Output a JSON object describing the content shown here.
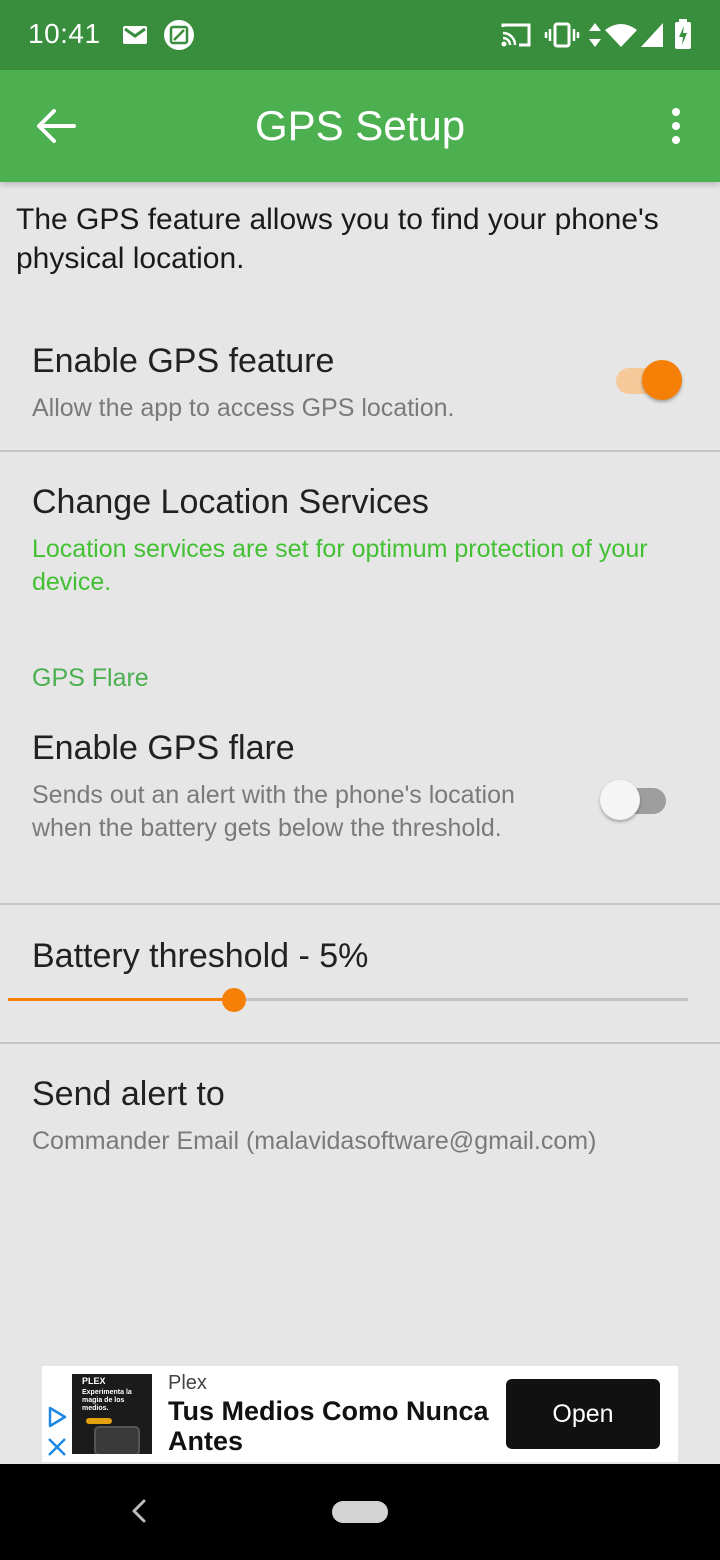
{
  "status_bar": {
    "time": "10:41",
    "icons": [
      "gmail-icon",
      "screenshot-icon",
      "cast-icon",
      "vibrate-icon",
      "data-arrows-icon",
      "wifi-icon",
      "signal-icon",
      "battery-charging-icon"
    ]
  },
  "app_bar": {
    "title": "GPS Setup",
    "back_icon": "arrow-back-icon",
    "menu_icon": "more-vert-icon"
  },
  "intro": "The GPS feature allows you to find your phone's physical location.",
  "settings": {
    "enable_gps": {
      "title": "Enable GPS feature",
      "summary": "Allow the app to access GPS location.",
      "enabled": true
    },
    "location_services": {
      "title": "Change Location Services",
      "summary": "Location services are set for optimum protection of your device."
    },
    "gps_flare_header": "GPS Flare",
    "enable_flare": {
      "title": "Enable GPS flare",
      "summary": "Sends out an alert with the phone's location when the battery gets below the threshold.",
      "enabled": false
    },
    "battery_threshold": {
      "title": "Battery threshold - 5%",
      "slider_fraction": 0.333
    },
    "send_alert": {
      "title": "Send alert to",
      "summary": "Commander Email (malavidasoftware@gmail.com)"
    }
  },
  "ad": {
    "image_brand": "PLEX",
    "image_tagline": "Experimenta la magia de los medios.",
    "advertiser": "Plex",
    "headline": "Tus Medios Como Nunca Antes",
    "cta": "Open"
  },
  "colors": {
    "status_bar": "#388e3c",
    "app_bar": "#4caf50",
    "accent": "#f57f07",
    "success_text": "#43c034",
    "background": "#e6e6e6"
  }
}
